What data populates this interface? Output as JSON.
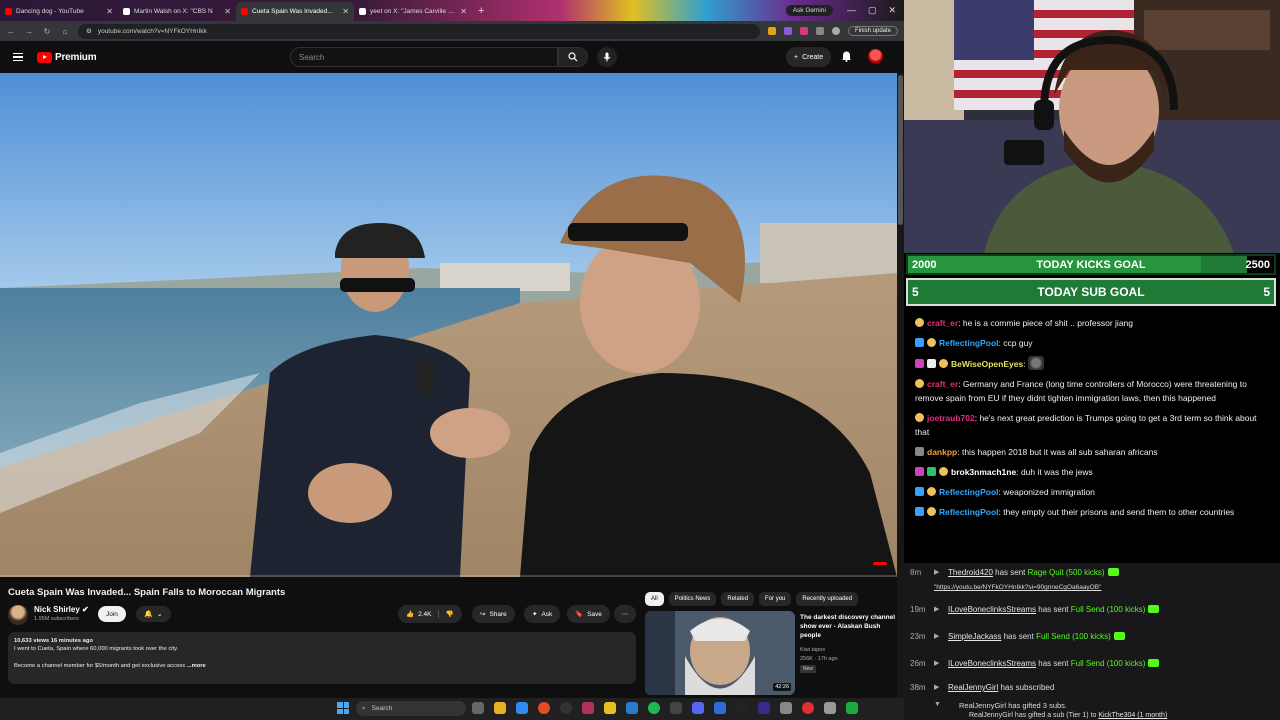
{
  "browser": {
    "tabs": [
      {
        "title": "Dancing dog - YouTube",
        "color": "#ff0000"
      },
      {
        "title": "Martin Walsh on X: \"CBS N",
        "color": "#ffffff"
      },
      {
        "title": "Cueta Spain Was Invaded...",
        "color": "#ff0000"
      },
      {
        "title": "yeet on X: \"James Carville anno",
        "color": "#ffffff"
      }
    ],
    "ask_gemini": "Ask Gemini",
    "url": "youtube.com/watch?v=NYFkOYHnIkk",
    "finish_update": "Finish update"
  },
  "youtube": {
    "brand": "Premium",
    "search_placeholder": "Search",
    "create_label": "Create"
  },
  "video": {
    "title": "Cueta Spain Was Invaded... Spain Falls to Moroccan Migrants",
    "channel": "Nick Shirley",
    "subscribers": "1.95M subscribers",
    "join_label": "Join",
    "likes": "2.4K",
    "share_label": "Share",
    "ask_label": "Ask",
    "save_label": "Save",
    "views_line": "10,633 views  16 minutes ago",
    "desc_line1": "I went to Cueta, Spain where 60,000 migrants took over the city.",
    "desc_line2": "Become a channel member for $5/month and get exclusive access",
    "more_label": "...more"
  },
  "filters": [
    "All",
    "Politics News",
    "Related",
    "For you",
    "Recently uploaded"
  ],
  "recommendation": {
    "title": "The darkest discovery channel show ever - Alaskan Bush people",
    "channel": "Kiwi tapes",
    "meta": "256K · 17h ago",
    "badge": "New",
    "duration": "42:26"
  },
  "taskbar": {
    "search_placeholder": "Search"
  },
  "goals": {
    "kicks": {
      "current": "2000",
      "label": "TODAY KICKS GOAL",
      "target": "2500",
      "progress": 0.8
    },
    "subs": {
      "current": "5",
      "label": "TODAY SUB GOAL",
      "target": "5"
    }
  },
  "chat": [
    {
      "user": "craft_er",
      "color": "#e0307a",
      "text": "he is a commie piece of shit .. professor jiang"
    },
    {
      "user": "ReflectingPool",
      "color": "#2ea8ff",
      "text": "ccp guy"
    },
    {
      "user": "BeWiseOpenEyes",
      "color": "#e6e35a",
      "text": ""
    },
    {
      "user": "craft_er",
      "color": "#e0307a",
      "text": "Germany and France (long time controllers of Morocco) were threatening to remove spain from EU if they didnt tighten immigration laws, then this happened"
    },
    {
      "user": "joetraub702",
      "color": "#e0307a",
      "text": "he's next great prediction is Trumps going to get a 3rd term so think about that"
    },
    {
      "user": "dankpp",
      "color": "#f0a030",
      "text": "this happen 2018 but it was all sub saharan africans"
    },
    {
      "user": "brok3nmach1ne",
      "color": "#ffffff",
      "text": "duh it was the jews"
    },
    {
      "user": "ReflectingPool",
      "color": "#2ea8ff",
      "text": "weaponized immigration"
    },
    {
      "user": "ReflectingPool",
      "color": "#2ea8ff",
      "text": "they empty out their prisons and send them to other countries"
    }
  ],
  "events": [
    {
      "time": "8m",
      "user": "Thedroid420",
      "action": "has sent",
      "item": "Rage Quit (500 kicks)"
    },
    {
      "time": "",
      "link": "\"https://youtu.be/NYFkOYHnIkk?si=90gnneCgOa6aayOB\""
    },
    {
      "time": "19m",
      "user": "ILoveBoneclinksStreams",
      "action": "has sent",
      "item": "Full Send (100 kicks)"
    },
    {
      "time": "23m",
      "user": "SimpleJackass",
      "action": "has sent",
      "item": "Full Send (100 kicks)"
    },
    {
      "time": "26m",
      "user": "ILoveBoneclinksStreams",
      "action": "has sent",
      "item": "Full Send (100 kicks)"
    },
    {
      "time": "38m",
      "user": "RealJennyGirl",
      "action": "has subscribed",
      "item": ""
    },
    {
      "time": "",
      "user": "RealJennyGirl",
      "action": "has gifted 3 subs.",
      "item": ""
    },
    {
      "time": "",
      "user": "RealJennyGirl",
      "action": "has gifted a sub (Tier 1) to",
      "item": "KickThe304 (1 month)"
    }
  ]
}
